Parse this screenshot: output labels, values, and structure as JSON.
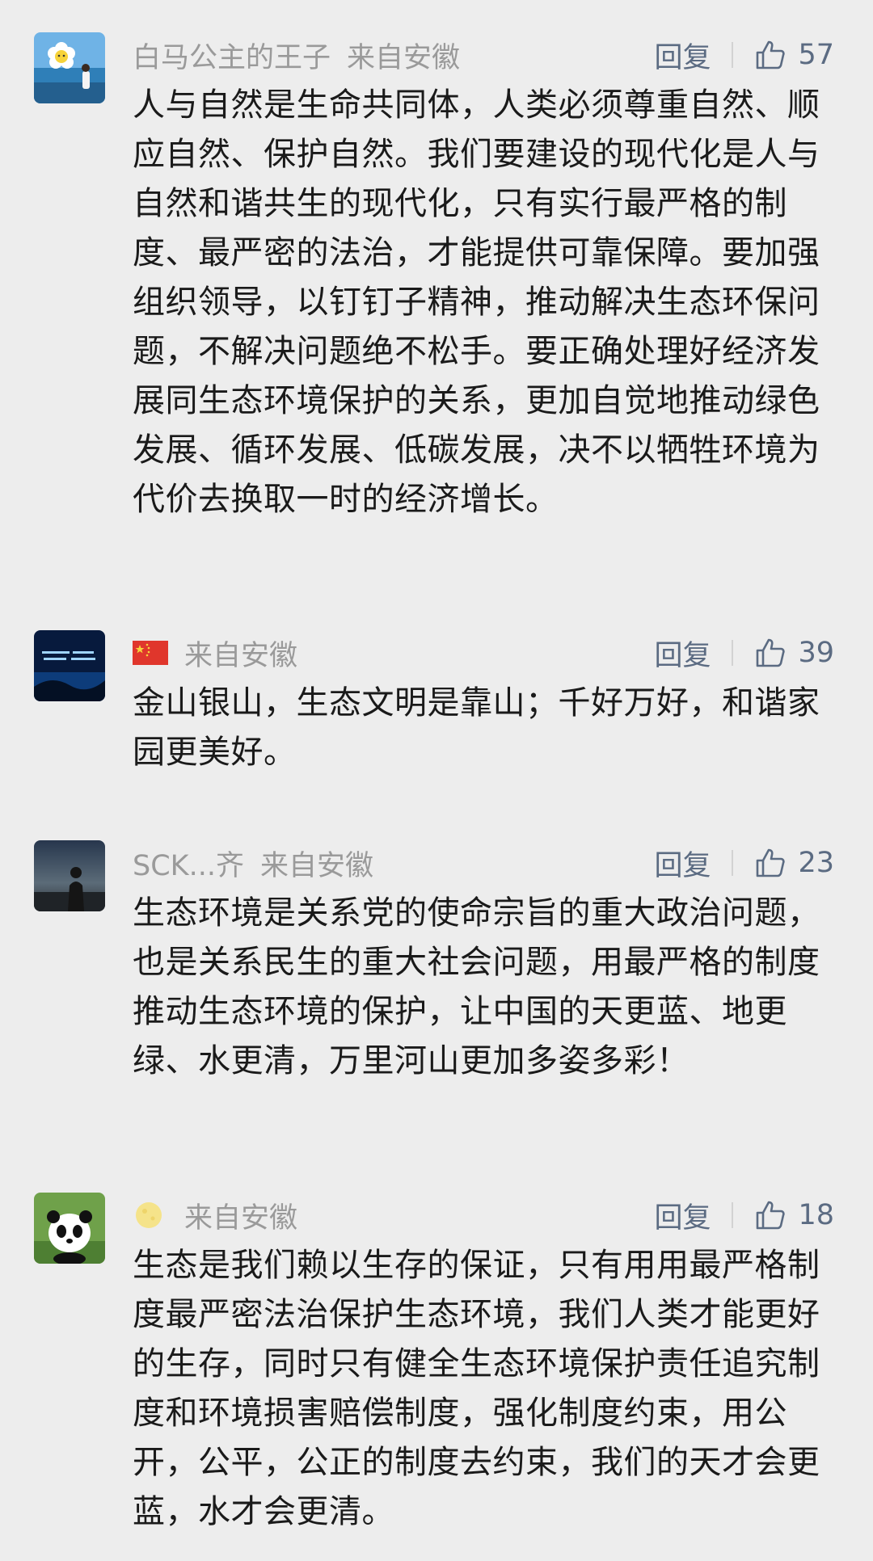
{
  "reply_label": "回复",
  "comments": [
    {
      "name": "白马公主的王子",
      "location": "来自安徽",
      "likes": "57",
      "text": "人与自然是生命共同体，人类必须尊重自然、顺应自然、保护自然。我们要建设的现代化是人与自然和谐共生的现代化，只有实行最严格的制度、最严密的法治，才能提供可靠保障。要加强组织领导，以钉钉子精神，推动解决生态环保问题，不解决问题绝不松手。要正确处理好经济发展同生态环境保护的关系，更加自觉地推动绿色发展、循环发展、低碳发展，决不以牺牲环境为代价去换取一时的经济增长。"
    },
    {
      "name": "",
      "name_icon": "china-flag-icon",
      "location": "来自安徽",
      "likes": "39",
      "text": "金山银山，生态文明是靠山；千好万好，和谐家园更美好。"
    },
    {
      "name": "SCK...齐",
      "location": "来自安徽",
      "likes": "23",
      "text": "生态环境是关系党的使命宗旨的重大政治问题，也是关系民生的重大社会问题，用最严格的制度推动生态环境的保护，让中国的天更蓝、地更绿、水更清，万里河山更加多姿多彩！"
    },
    {
      "name": "",
      "name_icon": "moon-icon",
      "location": "来自安徽",
      "likes": "18",
      "text": "生态是我们赖以生存的保证，只有用用最严格制度最严密法治保护生态环境，我们人类才能更好的生存，同时只有健全生态环境保护责任追究制度和环境损害赔偿制度，强化制度约束，用公开，公平，公正的制度去约束，我们的天才会更蓝，水才会更清。"
    }
  ]
}
